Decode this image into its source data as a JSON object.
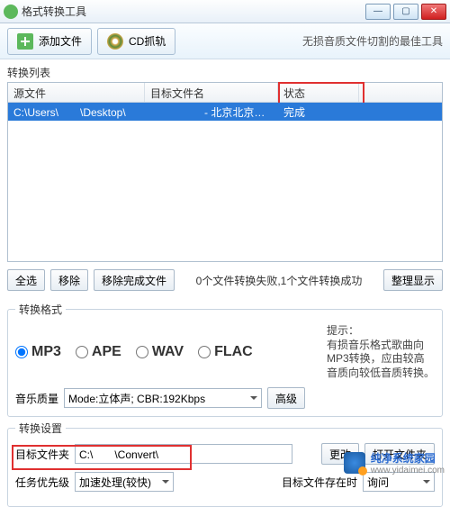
{
  "window": {
    "title": "格式转换工具"
  },
  "toolbar": {
    "add_file": "添加文件",
    "cd_rip": "CD抓轨",
    "tagline": "无损音质文件切割的最佳工具"
  },
  "list": {
    "section_label": "转换列表",
    "headers": {
      "source": "源文件",
      "target": "目标文件名",
      "status": "状态"
    },
    "rows": [
      {
        "source": "C:\\Users\\　　\\Desktop\\",
        "target": "　　　　　- 北京北京…",
        "status": "完成"
      }
    ]
  },
  "list_buttons": {
    "select_all": "全选",
    "remove": "移除",
    "remove_done": "移除完成文件",
    "tidy": "整理显示",
    "status_msg": "0个文件转换失败,1个文件转换成功"
  },
  "format": {
    "legend": "转换格式",
    "options": [
      "MP3",
      "APE",
      "WAV",
      "FLAC"
    ],
    "selected": "MP3",
    "hint_title": "提示：",
    "hint_body": "有损音乐格式歌曲向MP3转换，应由较高音质向较低音质转换。",
    "quality_label": "音乐质量",
    "quality_value": "Mode:立体声; CBR:192Kbps",
    "advanced": "高级"
  },
  "settings": {
    "legend": "转换设置",
    "dest_label": "目标文件夹",
    "dest_value": "C:\\　　\\Convert\\",
    "change": "更改",
    "open_folder": "打开文件夹",
    "priority_label": "任务优先级",
    "priority_value": "加速处理(较快)",
    "exists_label": "目标文件存在时",
    "exists_value": "询问"
  },
  "watermark": {
    "brand": "纯净系统家园",
    "url": "www.yidaimei.com"
  }
}
